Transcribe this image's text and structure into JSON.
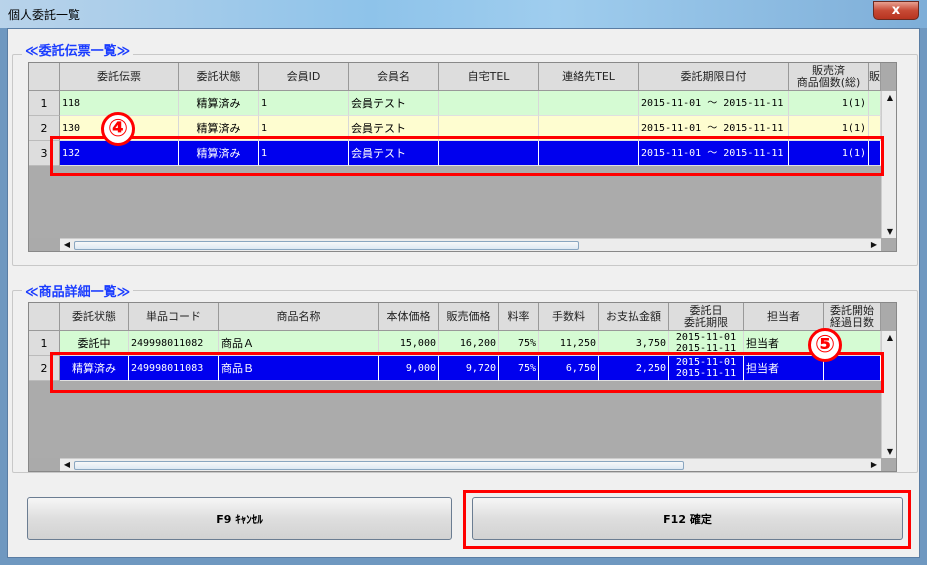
{
  "window": {
    "title": "個人委託一覧",
    "close_icon": "close-icon"
  },
  "group1": {
    "title": "≪委託伝票一覧≫",
    "headers": [
      "委託伝票",
      "委託状態",
      "会員ID",
      "会員名",
      "自宅TEL",
      "連絡先TEL",
      "委託期限日付",
      "販売済\n商品個数(総)",
      "販"
    ],
    "rows": [
      {
        "num": "1",
        "voucher": "118",
        "status": "精算済み",
        "member_id": "1",
        "member_name": "会員テスト",
        "home_tel": "",
        "contact_tel": "",
        "period": "2015-11-01 ～ 2015-11-11",
        "sold": "1(1)"
      },
      {
        "num": "2",
        "voucher": "130",
        "status": "精算済み",
        "member_id": "1",
        "member_name": "会員テスト",
        "home_tel": "",
        "contact_tel": "",
        "period": "2015-11-01 ～ 2015-11-11",
        "sold": "1(1)"
      },
      {
        "num": "3",
        "voucher": "132",
        "status": "精算済み",
        "member_id": "1",
        "member_name": "会員テスト",
        "home_tel": "",
        "contact_tel": "",
        "period": "2015-11-01 ～ 2015-11-11",
        "sold": "1(1)"
      }
    ],
    "annotation": "④"
  },
  "group2": {
    "title": "≪商品詳細一覧≫",
    "headers": [
      "委託状態",
      "単品コード",
      "商品名称",
      "本体価格",
      "販売価格",
      "料率",
      "手数料",
      "お支払金額",
      "委託日\n委託期限",
      "担当者",
      "委託開始\n経過日数"
    ],
    "rows": [
      {
        "num": "1",
        "status": "委託中",
        "code": "249998011082",
        "name": "商品Ａ",
        "base_price": "15,000",
        "sale_price": "16,200",
        "rate": "75%",
        "fee": "11,250",
        "payment": "3,750",
        "date1": "2015-11-01",
        "date2": "2015-11-11",
        "staff": "担当者",
        "elapsed": ""
      },
      {
        "num": "2",
        "status": "精算済み",
        "code": "249998011083",
        "name": "商品Ｂ",
        "base_price": "9,000",
        "sale_price": "9,720",
        "rate": "75%",
        "fee": "6,750",
        "payment": "2,250",
        "date1": "2015-11-01",
        "date2": "2015-11-11",
        "staff": "担当者",
        "elapsed": ""
      }
    ],
    "annotation": "⑤"
  },
  "buttons": {
    "cancel": "F9 ｷｬﾝｾﾙ",
    "confirm": "F12 確定"
  },
  "colors": {
    "selected": "#0000ee",
    "row_green": "#d5fbd3",
    "row_yellow": "#fefdd0",
    "annotation": "#ff0000",
    "title_blue": "#1a3cff"
  }
}
